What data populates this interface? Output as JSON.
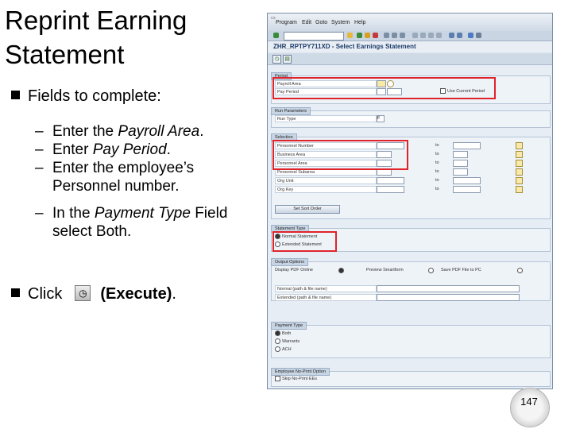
{
  "slide": {
    "title_line1": "Reprint Earning",
    "title_line2": "Statement",
    "bullet1": "Fields to complete:",
    "steps": [
      [
        "Enter the ",
        "Payroll Area",
        "."
      ],
      [
        "Enter ",
        "Pay Period",
        "."
      ],
      [
        "Enter the employee’s ",
        "Personnel number",
        "."
      ],
      [
        "In the ",
        "Payment Type",
        " Field select Both."
      ]
    ],
    "dash": "–",
    "click_label": "Click",
    "execute_label": "(Execute)",
    "execute_suffix": ".",
    "page_number": "147"
  },
  "sap": {
    "menu": [
      "Program",
      "Edit",
      "Goto",
      "System",
      "Help"
    ],
    "title": "ZHR_RPTPY711XD - Select Earnings Statement",
    "period": {
      "tab": "Period",
      "payroll_area_label": "Payroll Area",
      "pay_period_label": "Pay Period",
      "use_current_period": "Use Current Period"
    },
    "run_params": {
      "tab": "Run Parameters",
      "run_type_label": "Run Type",
      "run_type_value": "F"
    },
    "selection": {
      "tab": "Selection",
      "rows": [
        "Personnel Number",
        "Business Area",
        "Personnel Area",
        "Personnel Subarea",
        "Org Unit",
        "Org Key"
      ],
      "to_label": "to",
      "sort_button": "Set Sort Order"
    },
    "statement_type": {
      "tab": "Statement Type",
      "options": [
        "Normal Statement",
        "Extended Statement"
      ]
    },
    "output": {
      "tab": "Output Options",
      "options": [
        "Display PDF Online",
        "Preview Smartform",
        "Save PDF File to PC"
      ],
      "normal_path": "Normal (path & file name)",
      "extended_path": "Extended (path & file name)"
    },
    "payment_type": {
      "tab": "Payment Type",
      "options": [
        "Both",
        "Warrants",
        "ACH"
      ]
    },
    "no_print": {
      "tab": "Employee No-Print Option",
      "option": "Skip No-Print EEs"
    }
  },
  "colors": {
    "highlight": "#e0232b",
    "sap_title": "#1c3b68"
  }
}
